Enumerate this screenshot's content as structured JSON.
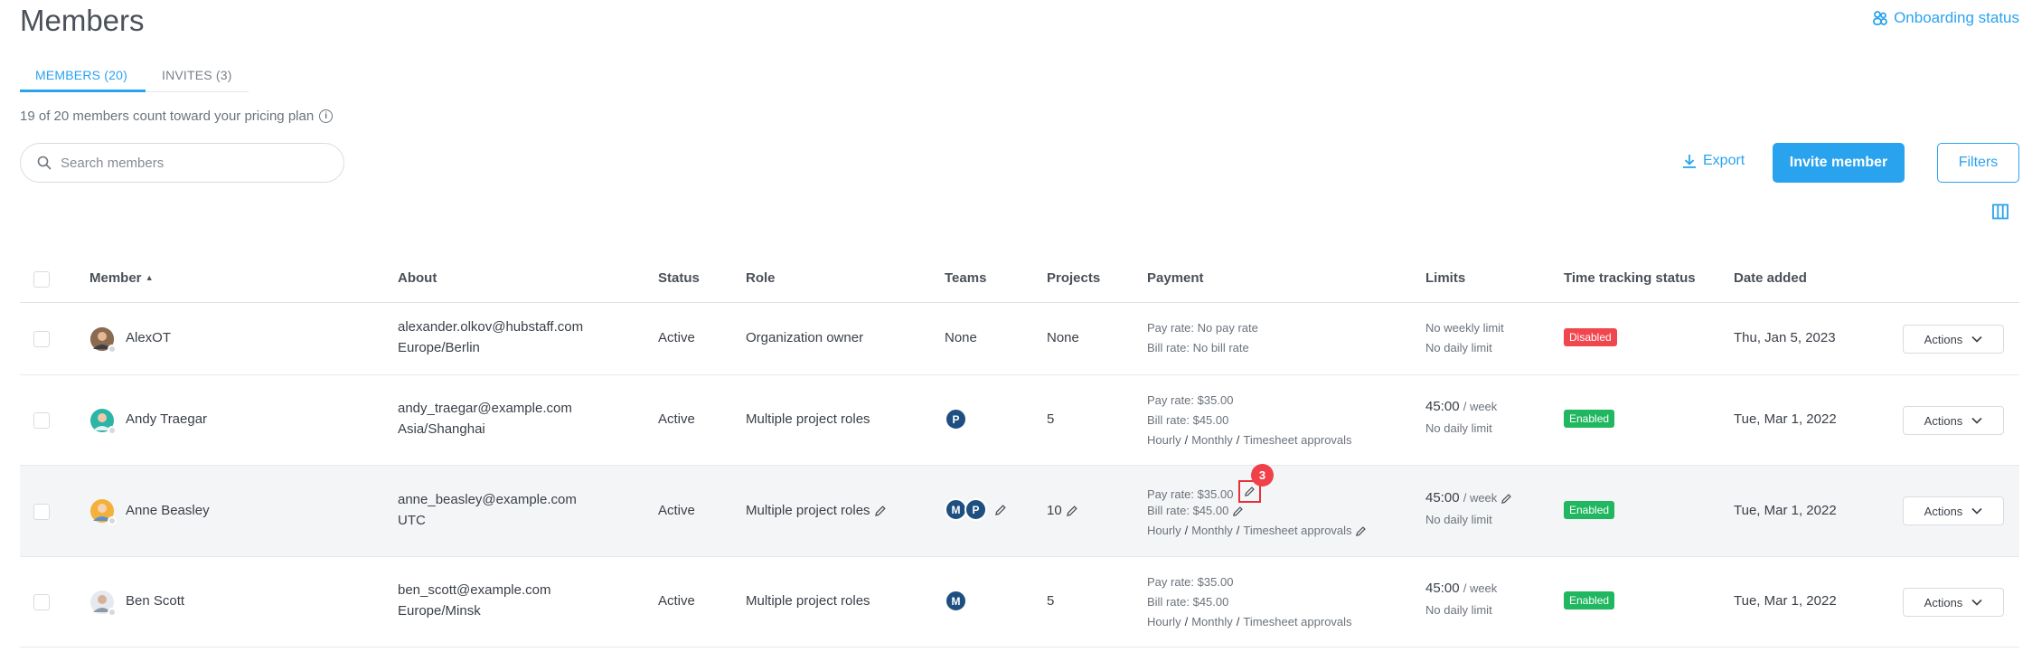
{
  "page": {
    "title": "Members"
  },
  "header": {
    "onboarding_label": "Onboarding status"
  },
  "tabs": [
    {
      "label": "MEMBERS (20)",
      "active": true
    },
    {
      "label": "INVITES (3)",
      "active": false
    }
  ],
  "plan_note": "19 of 20 members count toward your pricing plan",
  "search": {
    "placeholder": "Search members",
    "value": ""
  },
  "toolbar": {
    "export_label": "Export",
    "invite_label": "Invite member",
    "filters_label": "Filters"
  },
  "columns": {
    "member": "Member",
    "about": "About",
    "status": "Status",
    "role": "Role",
    "teams": "Teams",
    "projects": "Projects",
    "payment": "Payment",
    "limits": "Limits",
    "tracking": "Time tracking status",
    "date_added": "Date added"
  },
  "payment_labels": {
    "pay_rate": "Pay rate:",
    "bill_rate": "Bill rate:",
    "hourly": "Hourly",
    "monthly": "Monthly",
    "timesheet": "Timesheet approvals",
    "separator": "/"
  },
  "limit_labels": {
    "per_week": "/ week"
  },
  "actions_label": "Actions",
  "notification_count": "3",
  "members": [
    {
      "name": "AlexOT",
      "email": "alexander.olkov@hubstaff.com",
      "timezone": "Europe/Berlin",
      "status": "Active",
      "role": "Organization owner",
      "teams_text": "None",
      "projects": "None",
      "pay_rate": "No pay rate",
      "bill_rate": "No bill rate",
      "weekly_limit": "No weekly limit",
      "daily_limit": "No daily limit",
      "tracking": "Disabled",
      "date_added": "Thu, Jan 5, 2023",
      "avatar_color": "#6b4f3a"
    },
    {
      "name": "Andy Traegar",
      "email": "andy_traegar@example.com",
      "timezone": "Asia/Shanghai",
      "status": "Active",
      "role": "Multiple project roles",
      "teams": [
        "P"
      ],
      "projects": "5",
      "pay_rate": "$35.00",
      "bill_rate": "$45.00",
      "weekly_limit": "45:00",
      "daily_limit": "No daily limit",
      "tracking": "Enabled",
      "date_added": "Tue, Mar 1, 2022",
      "avatar_color": "#2bb5a6"
    },
    {
      "name": "Anne Beasley",
      "email": "anne_beasley@example.com",
      "timezone": "UTC",
      "status": "Active",
      "role": "Multiple project roles",
      "teams": [
        "M",
        "P"
      ],
      "projects": "10",
      "pay_rate": "$35.00",
      "bill_rate": "$45.00",
      "weekly_limit": "45:00",
      "daily_limit": "No daily limit",
      "tracking": "Enabled",
      "date_added": "Tue, Mar 1, 2022",
      "avatar_color": "#f2b13a"
    },
    {
      "name": "Ben Scott",
      "email": "ben_scott@example.com",
      "timezone": "Europe/Minsk",
      "status": "Active",
      "role": "Multiple project roles",
      "teams": [
        "M"
      ],
      "projects": "5",
      "pay_rate": "$35.00",
      "bill_rate": "$45.00",
      "weekly_limit": "45:00",
      "daily_limit": "No daily limit",
      "tracking": "Enabled",
      "date_added": "Tue, Mar 1, 2022",
      "avatar_color": "#c7d3de"
    }
  ]
}
